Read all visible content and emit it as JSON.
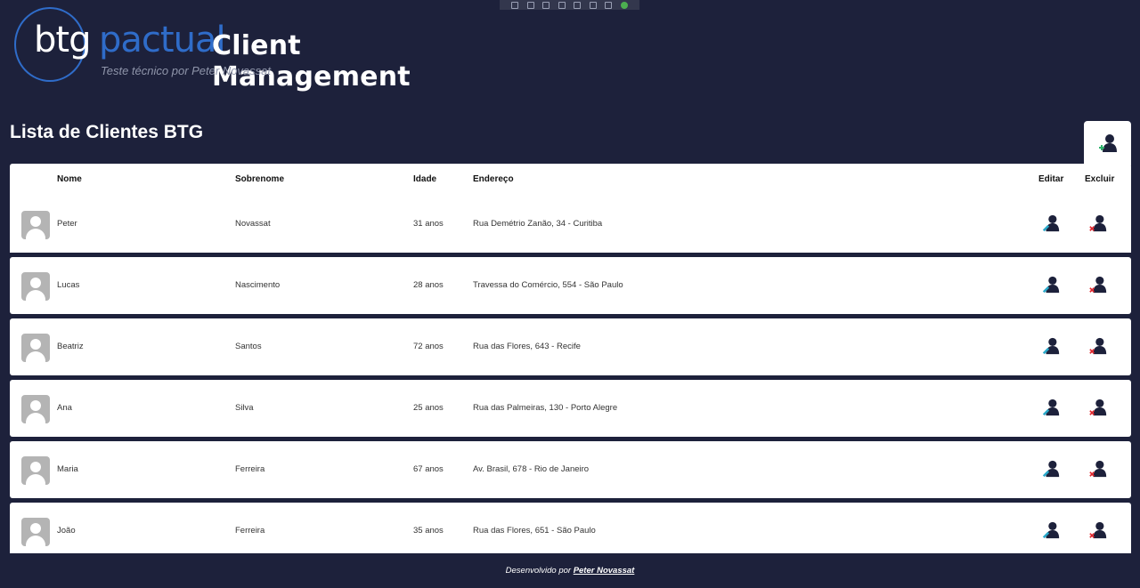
{
  "brand": {
    "logo_part1": "btg",
    "logo_part2": "pactual",
    "app_title": "Client Management",
    "subtitle": "Teste técnico por Peter Novassat",
    "logo_color": "#2f6cc9"
  },
  "page": {
    "title": "Lista de Clientes BTG",
    "add_icon": "add-user-icon"
  },
  "table": {
    "headers": {
      "nome": "Nome",
      "sobrenome": "Sobrenome",
      "idade": "Idade",
      "endereco": "Endereço",
      "editar": "Editar",
      "excluir": "Excluir"
    },
    "rows": [
      {
        "nome": "Peter",
        "sobrenome": "Novassat",
        "idade": "31 anos",
        "endereco": "Rua Demétrio Zanão, 34 - Curitiba"
      },
      {
        "nome": "Lucas",
        "sobrenome": "Nascimento",
        "idade": "28 anos",
        "endereco": "Travessa do Comércio, 554 - São Paulo"
      },
      {
        "nome": "Beatriz",
        "sobrenome": "Santos",
        "idade": "72 anos",
        "endereco": "Rua das Flores, 643 - Recife"
      },
      {
        "nome": "Ana",
        "sobrenome": "Silva",
        "idade": "25 anos",
        "endereco": "Rua das Palmeiras, 130 - Porto Alegre"
      },
      {
        "nome": "Maria",
        "sobrenome": "Ferreira",
        "idade": "67 anos",
        "endereco": "Av. Brasil, 678 - Rio de Janeiro"
      },
      {
        "nome": "João",
        "sobrenome": "Ferreira",
        "idade": "35 anos",
        "endereco": "Rua das Flores, 651 - São Paulo"
      }
    ]
  },
  "footer": {
    "prefix": "Desenvolvido por",
    "author": "Peter Novassat"
  },
  "colors": {
    "background": "#1d213b",
    "edit_accent": "#29a8c9",
    "delete_accent": "#e0242b",
    "icon_dark": "#1d213b"
  }
}
